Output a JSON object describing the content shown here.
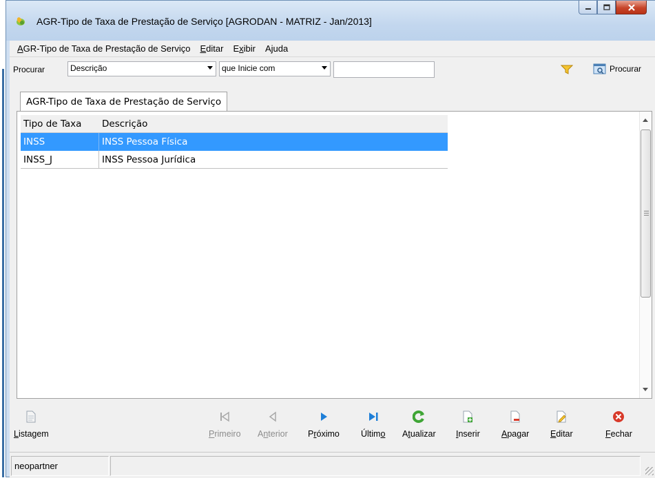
{
  "window": {
    "title": "AGR-Tipo de Taxa de Prestação de Serviço [AGRODAN - MATRIZ - Jan/2013]",
    "app_icon": "leaf-icon",
    "buttons": {
      "minimize": "minimize-icon",
      "maximize": "maximize-icon",
      "close": "close-icon"
    }
  },
  "menu": {
    "items": [
      {
        "label": "AGR-Tipo de Taxa de Prestação de Serviço",
        "accel": "A",
        "rest": "GR-Tipo de Taxa de Prestação de Serviço"
      },
      {
        "label": "Editar",
        "accel": "E",
        "rest": "ditar"
      },
      {
        "label": "Exibir",
        "pre": "E",
        "accel": "x",
        "rest": "ibir"
      },
      {
        "label": "Ajuda",
        "pre": "A",
        "accel": "j",
        "rest": "uda"
      }
    ]
  },
  "search": {
    "label": "Procurar",
    "field_value": "Descrição",
    "condition_value": "que Inicie com",
    "input_value": "",
    "filter_icon": "funnel-icon",
    "search_button_label": "Procurar",
    "search_icon": "search-window-icon"
  },
  "tab": {
    "label": "AGR-Tipo de Taxa de Prestação de Serviço"
  },
  "grid": {
    "columns": [
      "Tipo de Taxa",
      "Descrição"
    ],
    "rows": [
      {
        "tipo": "INSS",
        "descricao": "INSS Pessoa Física",
        "selected": true
      },
      {
        "tipo": "INSS_J",
        "descricao": "INSS Pessoa Jurídica",
        "selected": false
      }
    ]
  },
  "toolbar": {
    "listagem": {
      "label": "Listagem",
      "accel": "L",
      "rest": "istagem",
      "icon": "document-icon"
    },
    "primeiro": {
      "label": "Primeiro",
      "accel": "P",
      "rest": "rimeiro",
      "icon": "first-icon",
      "enabled": false
    },
    "anterior": {
      "label": "Anterior",
      "pre": "A",
      "accel": "n",
      "rest": "terior",
      "icon": "previous-icon",
      "enabled": false
    },
    "proximo": {
      "label": "Próximo",
      "pre": "P",
      "accel": "r",
      "rest": "óximo",
      "icon": "next-icon"
    },
    "ultimo": {
      "label": "Último",
      "pre": "Últim",
      "accel": "o",
      "rest": "",
      "icon": "last-icon"
    },
    "atualizar": {
      "label": "Atualizar",
      "pre": "A",
      "accel": "t",
      "rest": "ualizar",
      "icon": "refresh-icon"
    },
    "inserir": {
      "label": "Inserir",
      "accel": "I",
      "rest": "nserir",
      "icon": "insert-icon"
    },
    "apagar": {
      "label": "Apagar",
      "accel": "A",
      "rest": "pagar",
      "icon": "delete-icon"
    },
    "editar": {
      "label": "Editar",
      "accel": "E",
      "rest": "ditar",
      "icon": "edit-icon"
    },
    "fechar": {
      "label": "Fechar",
      "accel": "F",
      "rest": "echar",
      "icon": "close-circle-icon"
    }
  },
  "status": {
    "user": "neopartner",
    "pane2": ""
  },
  "colors": {
    "selection": "#3399ff",
    "next_blue": "#1e7fd8",
    "refresh_green": "#3fa535",
    "close_red": "#d83a2a"
  }
}
